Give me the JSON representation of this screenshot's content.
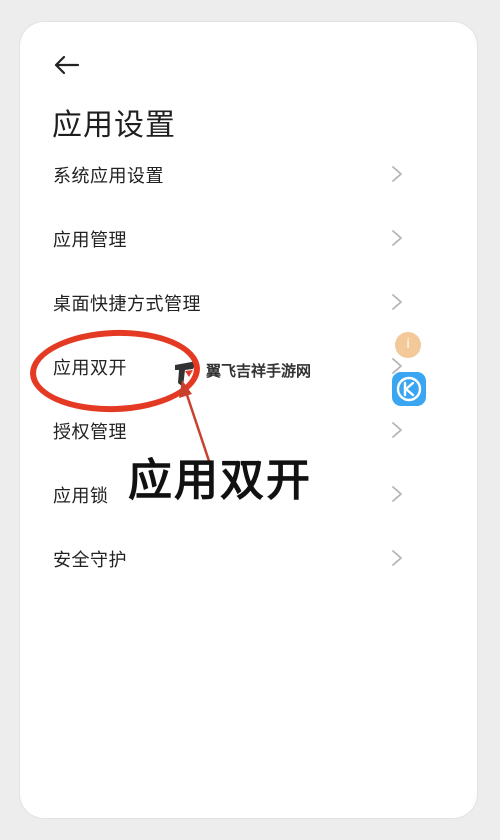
{
  "page": {
    "title": "应用设置"
  },
  "menu": {
    "items": [
      {
        "label": "系统应用设置"
      },
      {
        "label": "应用管理"
      },
      {
        "label": "桌面快捷方式管理"
      },
      {
        "label": "应用双开"
      },
      {
        "label": "授权管理"
      },
      {
        "label": "应用锁"
      },
      {
        "label": "安全守护"
      }
    ]
  },
  "annotation": {
    "callout_text": "应用双开",
    "highlight_color": "#e43a24"
  },
  "watermark": {
    "text": "翼飞吉祥手游网"
  },
  "floating": {
    "bubble_glyph": "i",
    "k_icon": "k-app-icon"
  },
  "icons": {
    "back": "back-arrow-icon",
    "chevron": "chevron-right-icon"
  }
}
